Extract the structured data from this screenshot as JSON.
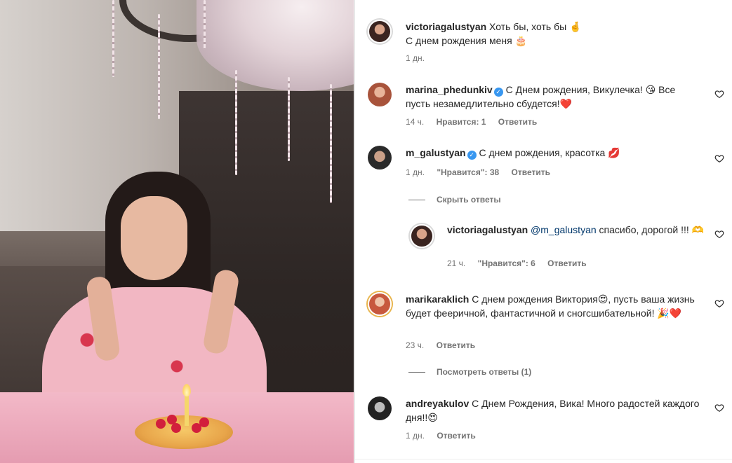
{
  "comments": [
    {
      "username": "victoriagalustyan",
      "text": "Хоть бы, хоть бы 🤞",
      "text2": "С днем рождения меня 🎂",
      "time": "1 дн."
    },
    {
      "username": "marina_phedunkiv",
      "verified": true,
      "text": "С Днем рождения, Викулечка! 😘 Все пусть незамедлительно сбудется!❤️",
      "time": "14 ч.",
      "likes": "Нравится: 1",
      "reply": "Ответить"
    },
    {
      "username": "m_galustyan",
      "verified": true,
      "text": "С днем рождения, красотка 💋",
      "time": "1 дн.",
      "likes": "\"Нравится\": 38",
      "reply": "Ответить",
      "toggle": "Скрыть ответы"
    },
    {
      "username": "victoriagalustyan",
      "mention": "@m_galustyan",
      "text": " спасибо, дорогой !!! 🫶",
      "time": "21 ч.",
      "likes": "\"Нравится\": 6",
      "reply": "Ответить"
    },
    {
      "username": "marikaraklich",
      "text": "С днем рождения Виктория😍, пусть ваша жизнь будет фееричной, фантастичной и сногсшибательной! 🎉❤️",
      "time": "23 ч.",
      "reply": "Ответить",
      "toggle": "Посмотреть ответы (1)"
    },
    {
      "username": "andreyakulov",
      "text": "С Днем Рождения, Вика! Много радостей каждого дня!!😍",
      "time": "1 дн.",
      "reply": "Ответить"
    }
  ],
  "icons": {
    "like": "heart-icon",
    "verified": "verified-badge-icon"
  },
  "colors": {
    "verified": "#3897f0",
    "meta": "#737373",
    "mention": "#00376b"
  }
}
